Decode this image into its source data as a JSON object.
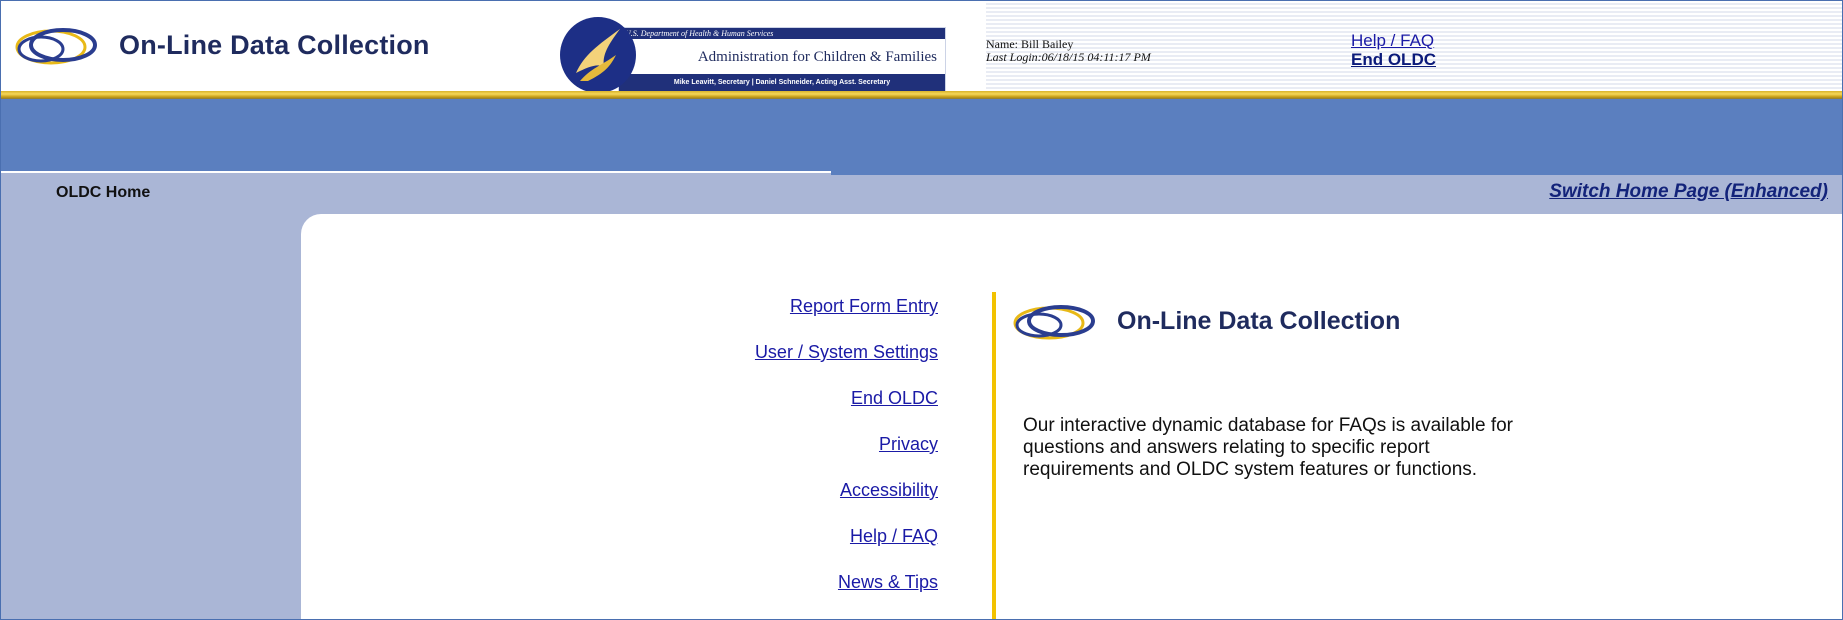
{
  "header": {
    "app_title": "On-Line Data Collection",
    "acf": {
      "top_line": "U.S. Department of Health & Human Services",
      "name": "Administration for Children & Families",
      "bottom_line": "Mike Leavitt, Secretary  |  Daniel Schneider, Acting Asst. Secretary"
    },
    "user": {
      "name": "Name: Bill Bailey",
      "last_login": "Last Login:06/18/15 04:11:17 PM"
    },
    "links": {
      "help": "Help / FAQ",
      "end": "End OLDC"
    }
  },
  "subbar": {
    "breadcrumb": "OLDC Home",
    "switch_link": "Switch Home Page (Enhanced)"
  },
  "nav_menu": [
    {
      "label": "Report Form Entry"
    },
    {
      "label": "User / System Settings"
    },
    {
      "label": "End OLDC"
    },
    {
      "label": "Privacy"
    },
    {
      "label": "Accessibility"
    },
    {
      "label": "Help / FAQ"
    },
    {
      "label": "News & Tips"
    }
  ],
  "panel": {
    "title": "On-Line Data Collection",
    "description": "Our interactive dynamic database for FAQs is available for questions and answers relating to specific report requirements and OLDC system features or functions."
  },
  "colors": {
    "nav_blue": "#5b7fbf",
    "sidebar": "#aab6d6",
    "gold": "#f2c200",
    "link": "#1a1aa6",
    "brand_navy": "#1f2b5e"
  },
  "icons": {
    "logo": "oldc-rings-logo",
    "agency": "hhs-eagle-seal"
  }
}
